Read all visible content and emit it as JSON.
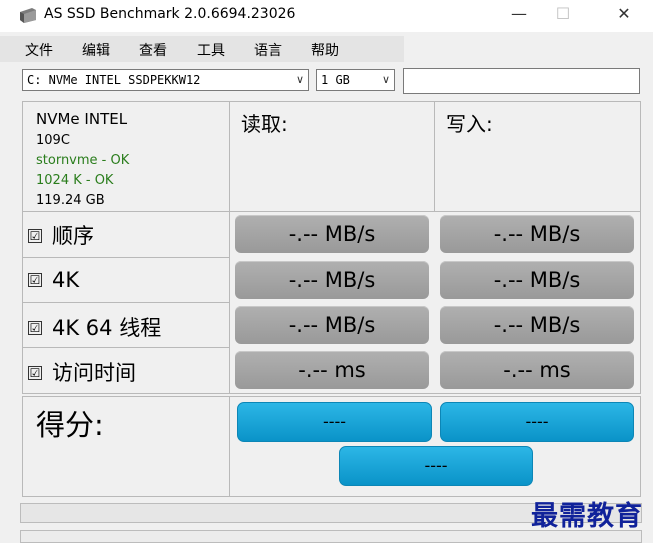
{
  "window": {
    "title": "AS SSD Benchmark 2.0.6694.23026",
    "controls": {
      "minimize": "—",
      "maximize": "☐",
      "close": "✕"
    }
  },
  "menu": [
    "文件",
    "编辑",
    "查看",
    "工具",
    "语言",
    "帮助"
  ],
  "drive_select": {
    "value": "C: NVMe INTEL SSDPEKKW12"
  },
  "size_select": {
    "value": "1 GB"
  },
  "path_field": {
    "value": ""
  },
  "drive_info": {
    "model": "NVMe INTEL",
    "firmware": "109C",
    "driver": "stornvme - OK",
    "alignment": "1024 K - OK",
    "capacity": "119.24 GB"
  },
  "headers": {
    "read": "读取:",
    "write": "写入:"
  },
  "tests": [
    {
      "label": "顺序",
      "checked": "☑",
      "read": "-.-- MB/s",
      "write": "-.-- MB/s"
    },
    {
      "label": "4K",
      "checked": "☑",
      "read": "-.-- MB/s",
      "write": "-.-- MB/s"
    },
    {
      "label": "4K 64 线程",
      "checked": "☑",
      "read": "-.-- MB/s",
      "write": "-.-- MB/s"
    },
    {
      "label": "访问时间",
      "checked": "☑",
      "read": "-.-- ms",
      "write": "-.-- ms"
    }
  ],
  "score": {
    "label": "得分:",
    "read": "----",
    "write": "----",
    "total": "----"
  },
  "watermark": "最需教育",
  "colors": {
    "accent": "#12a3d6",
    "ok_text": "#2a7d1c",
    "result_button": "#a6a6a6",
    "watermark": "#10229a"
  }
}
